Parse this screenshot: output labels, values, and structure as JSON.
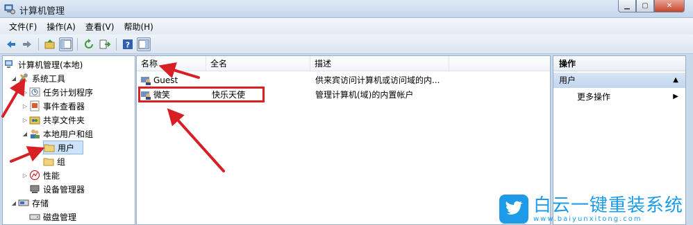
{
  "window": {
    "title": "计算机管理"
  },
  "window_controls": {
    "minimize": "▁",
    "maximize": "▢",
    "close": "✕"
  },
  "menu": [
    "文件(F)",
    "操作(A)",
    "查看(V)",
    "帮助(H)"
  ],
  "toolbar": {
    "icons": [
      "back-icon",
      "forward-icon",
      "up-folder-icon",
      "show-hide-tree-icon",
      "refresh-icon",
      "export-icon",
      "help-icon",
      "show-hide-action-icon"
    ]
  },
  "tree": {
    "items": [
      {
        "label": "计算机管理(本地)"
      },
      {
        "label": "系统工具"
      },
      {
        "label": "任务计划程序"
      },
      {
        "label": "事件查看器"
      },
      {
        "label": "共享文件夹"
      },
      {
        "label": "本地用户和组"
      },
      {
        "label": "用户"
      },
      {
        "label": "组"
      },
      {
        "label": "性能"
      },
      {
        "label": "设备管理器"
      },
      {
        "label": "存储"
      },
      {
        "label": "磁盘管理"
      }
    ]
  },
  "list": {
    "columns": [
      "名称",
      "全名",
      "描述"
    ],
    "rows": [
      {
        "name": "Guest",
        "fullname": "",
        "description": "供来宾访问计算机或访问域的内..."
      },
      {
        "name": "微笑",
        "fullname": "快乐天使",
        "description": "管理计算机(域)的内置帐户"
      }
    ]
  },
  "actions": {
    "header": "操作",
    "section": "用户",
    "item": "更多操作"
  },
  "watermark": {
    "name": "白云一键重装系统",
    "url": "www.baiyunxitong.com"
  },
  "colors": {
    "annotation": "#d81f26",
    "selection": "#cce3fb",
    "brand": "#1d9be8"
  }
}
